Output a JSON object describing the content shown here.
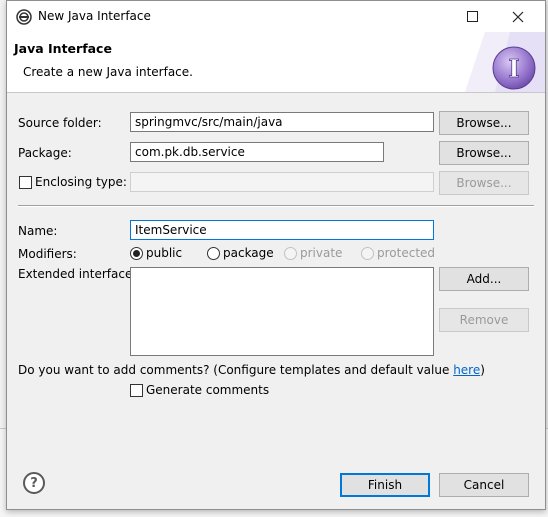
{
  "window": {
    "title": "New Java Interface"
  },
  "banner": {
    "title": "Java Interface",
    "description": "Create a new Java interface.",
    "icon_letter": "I"
  },
  "form": {
    "source_folder": {
      "label": "Source folder:",
      "value": "springmvc/src/main/java",
      "browse": "Browse..."
    },
    "package": {
      "label": "Package:",
      "value": "com.pk.db.service",
      "browse": "Browse..."
    },
    "enclosing": {
      "label": "Enclosing type:",
      "value": "",
      "browse": "Browse..."
    },
    "name": {
      "label": "Name:",
      "value": "ItemService"
    },
    "modifiers": {
      "label": "Modifiers:",
      "options": [
        "public",
        "package",
        "private",
        "protected"
      ],
      "selected": "public"
    },
    "extended": {
      "label": "Extended interfaces:",
      "add": "Add...",
      "remove": "Remove"
    },
    "comments": {
      "question": "Do you want to add comments? (Configure templates and default value ",
      "link": "here",
      "suffix": ")",
      "generate": "Generate comments"
    }
  },
  "footer": {
    "help": "?",
    "finish": "Finish",
    "cancel": "Cancel"
  },
  "colors": {
    "accent": "#0078d7",
    "link": "#0066cc",
    "icon_purple": "#8e6bc8"
  }
}
